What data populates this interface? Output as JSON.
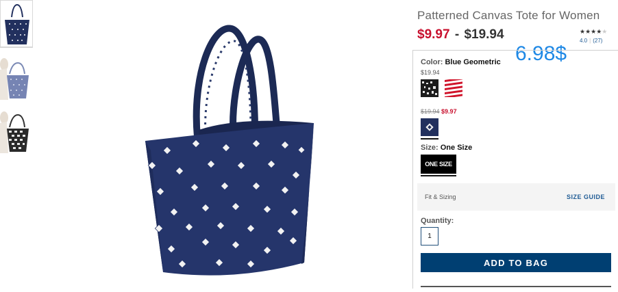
{
  "product": {
    "title": "Patterned Canvas Tote for Women",
    "sale_price": "$9.97",
    "separator": "-",
    "regular_price": "$19.94"
  },
  "rating": {
    "stars_filled": "★★★★",
    "stars_empty": "★",
    "score": "4.0",
    "reviews": "(27)"
  },
  "overlay": {
    "price_note": "6.98$"
  },
  "color": {
    "label": "Color:",
    "selected": "Blue Geometric",
    "group1_price": "$19.94",
    "group2_old_price": "$19.94",
    "group2_new_price": "$9.97",
    "swatches": [
      "black-white-pattern",
      "red-white-stripes",
      "blue-geometric"
    ]
  },
  "size": {
    "label": "Size:",
    "selected": "One Size",
    "option": "ONE SIZE"
  },
  "fit": {
    "label": "Fit & Sizing",
    "guide": "SIZE GUIDE"
  },
  "quantity": {
    "label": "Quantity:",
    "value": "1"
  },
  "actions": {
    "add_to_bag": "ADD TO BAG"
  },
  "colors": {
    "sale_red": "#c8102e",
    "navy": "#003f72",
    "link_blue": "#1f5b94",
    "overlay_blue": "#1e88e5",
    "tote_navy": "#22305e"
  }
}
